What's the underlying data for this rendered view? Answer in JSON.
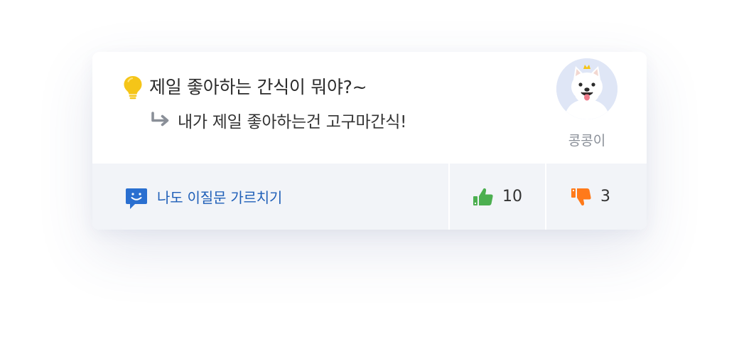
{
  "question": {
    "icon": "lightbulb-icon",
    "text": "제일 좋아하는 간식이 뭐야?~"
  },
  "answer": {
    "icon": "reply-arrow-icon",
    "text": "내가 제일 좋아하는건 고구마간식!"
  },
  "author": {
    "name": "콩콩이",
    "avatar": "dog-avatar"
  },
  "actions": {
    "teach_label": "나도 이질문 가르치기",
    "teach_icon": "chat-bubble-smile-icon",
    "like_count": "10",
    "dislike_count": "3",
    "like_icon": "thumbs-up-icon",
    "dislike_icon": "thumbs-down-icon"
  },
  "colors": {
    "bulb": "#f5c518",
    "teach": "#1f5fb8",
    "like": "#4caf50",
    "dislike": "#ff7a1a",
    "footer_bg": "#f2f4f8",
    "arrow": "#8a8f98"
  }
}
